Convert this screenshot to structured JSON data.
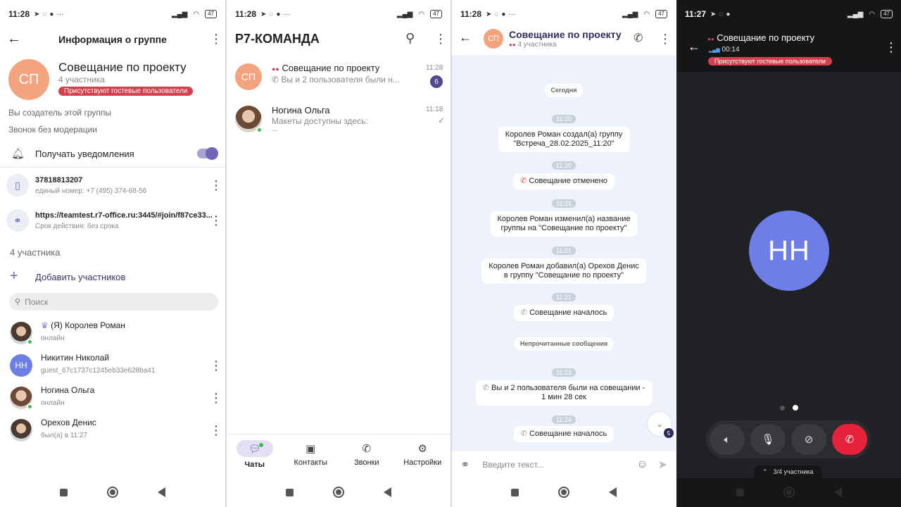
{
  "status1": {
    "time": "11:28",
    "battery": "47"
  },
  "status2": {
    "time": "11:28",
    "battery": "47"
  },
  "status3": {
    "time": "11:28",
    "battery": "47"
  },
  "status4": {
    "time": "11:27",
    "battery": "47"
  },
  "group_info": {
    "header_title": "Информация о группе",
    "avatar_initials": "СП",
    "name": "Совещание по проекту",
    "members_count": "4 участника",
    "guest_badge": "Присутствуют гостевые пользователи",
    "creator_note": "Вы создатель этой группы",
    "moderation_note": "Звонок без модерации",
    "notifications_label": "Получать уведомления",
    "phone": {
      "number": "37818813207",
      "sub": "единый номер: +7 (495) 374-68-56"
    },
    "link": {
      "url": "https://teamtest.r7-office.ru:3445/#join/f87ce33...",
      "sub": "Срок действия: без срока"
    },
    "members_header": "4 участника",
    "add_members": "Добавить участников",
    "search_placeholder": "Поиск",
    "members": [
      {
        "name": "(Я) Королев Роман",
        "status": "онлайн"
      },
      {
        "initials": "НН",
        "name": "Никитин Николай",
        "status": "guest_67c1737c1245eb33e628ba41"
      },
      {
        "name": "Ногина Ольга",
        "status": "онлайн"
      },
      {
        "name": "Орехов Денис",
        "status": "был(а) в 11:27"
      }
    ]
  },
  "chats": {
    "title": "Р7-КОМАНДА",
    "items": [
      {
        "avatar": "СП",
        "name": "Совещание по проекту",
        "preview": "Вы и 2 пользователя были н...",
        "time": "11:28",
        "unread": "6"
      },
      {
        "name": "Ногина Ольга",
        "preview": "Макеты доступны здесь:",
        "preview2": "...",
        "time": "11:18"
      }
    ],
    "tabs": [
      {
        "label": "Чаты"
      },
      {
        "label": "Контакты"
      },
      {
        "label": "Звонки"
      },
      {
        "label": "Настройки"
      }
    ]
  },
  "chat": {
    "avatar": "СП",
    "title": "Совещание по проекту",
    "subtitle": "4 участника",
    "day": "Сегодня",
    "messages": [
      {
        "time": "11:20",
        "text1": "Королев Роман создал(а) группу",
        "text2": "\"Встреча_28.02.2025_11:20\""
      },
      {
        "time": "11:20",
        "text1": "Совещание отменено"
      },
      {
        "time": "11:21",
        "text1": "Королев Роман изменил(а) название",
        "text2": "группы на \"Совещание по проекту\""
      },
      {
        "time": "11:21",
        "text1": "Королев Роман добавил(а) Орехов Денис",
        "text2": "в группу \"Совещание по проекту\""
      },
      {
        "time": "11:21",
        "text1": "Совещание началось"
      },
      {
        "time": "11:23",
        "text1": "Вы и 2 пользователя были на совещании -",
        "text2": "1 мин 28 сек"
      },
      {
        "time": "11:24",
        "text1": "Совещание началось"
      }
    ],
    "unread_label": "Непрочитанные сообщения",
    "scroll_badge": "5",
    "input_placeholder": "Введите текст..."
  },
  "call": {
    "title": "Совещание по проекту",
    "duration": "00:14",
    "guest_badge": "Присутствуют гостевые пользователи",
    "avatar": "НН",
    "participants": "3/4 участника",
    "colors": {
      "avatar": "#6d7fe6",
      "hangup": "#e5213b"
    }
  }
}
